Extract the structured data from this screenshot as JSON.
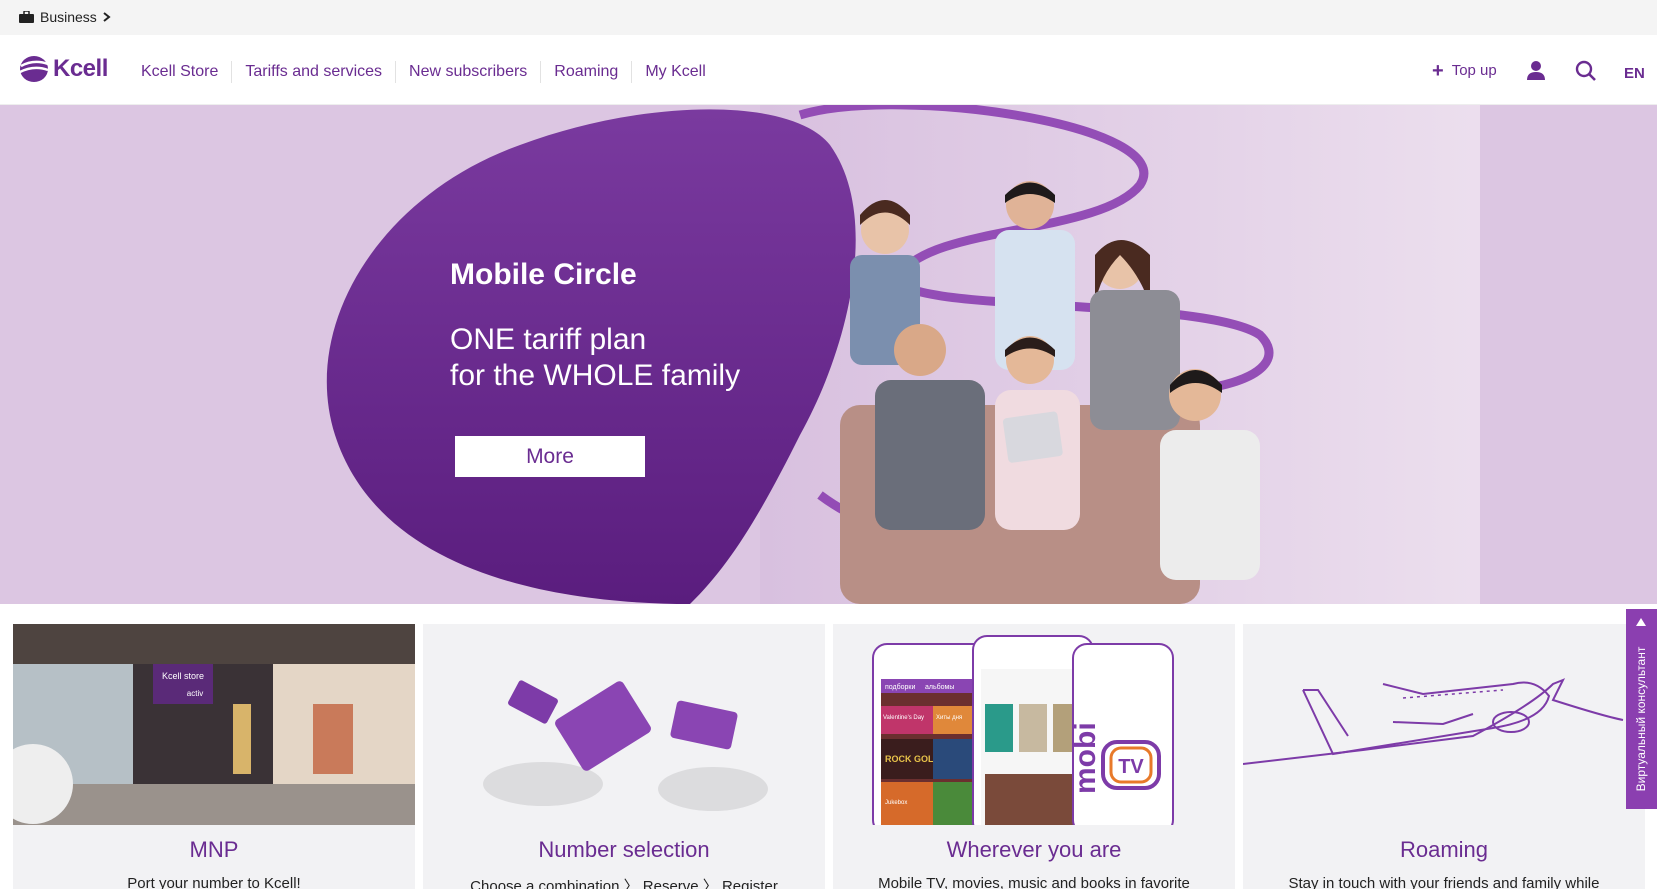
{
  "bizbar": {
    "label": "Business"
  },
  "header": {
    "logo_text": "Kcell",
    "nav": [
      "Kcell Store",
      "Tariffs and services",
      "New subscribers",
      "Roaming",
      "My Kcell"
    ],
    "topup_label": "Top up",
    "lang": "EN"
  },
  "hero": {
    "title": "Mobile Circle",
    "line1": "ONE tariff plan",
    "line2": "for the WHOLE family",
    "button": "More"
  },
  "cards": [
    {
      "title": "MNP",
      "desc": "Port your number to Kcell!"
    },
    {
      "title": "Number selection",
      "desc": "Choose a combination 〉 Reserve 〉 Register"
    },
    {
      "title": "Wherever you are",
      "desc": "Mobile TV, movies, music and books in favorite"
    },
    {
      "title": "Roaming",
      "desc": "Stay in touch with your friends and family while"
    }
  ],
  "card_images": {
    "store_sign": "Kcell store",
    "store_sub": "activ",
    "tv_word": "mobi",
    "tv_badge": "TV",
    "phone_items": [
      "подборки",
      "альбомы",
      "Valentine's Day",
      "Хиты дня",
      "ROCK GOLD",
      "Jukebox"
    ]
  },
  "consultant": {
    "label": "Виртуальный консультант"
  },
  "colors": {
    "brand": "#6a2c91",
    "hero_bg": "#dcc6e2",
    "blob": "#6f2e93"
  }
}
